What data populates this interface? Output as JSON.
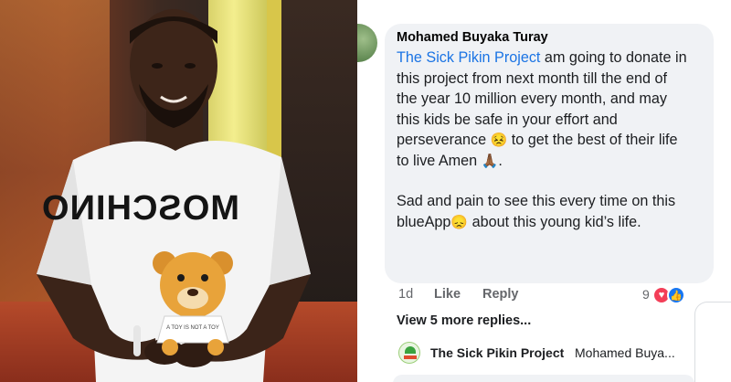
{
  "comment": {
    "author": "Mohamed Buyaka Turay",
    "mention": "The Sick Pikin Project",
    "para1_a": " am going to donate in this project from next month till the end of the year 10 million every month, and may this kids be safe in your effort and perseverance ",
    "emoji_1": "😣",
    "para1_b": " to get the best of their life to live Amen ",
    "emoji_2": "🙏🏾",
    "para1_c": ".",
    "para2_a": "Sad and pain to see this every time on this blueApp",
    "emoji_3": "😞",
    "para2_b": " about this young kid’s life."
  },
  "actions": {
    "time": "1d",
    "like": "Like",
    "reply": "Reply",
    "reaction_count": "9"
  },
  "view_more": "View 5 more replies...",
  "latest_reply": {
    "author": "The Sick Pikin Project",
    "preview": "Mohamed Buya..."
  },
  "colors": {
    "mention": "#1b74e4",
    "bubble": "#f0f2f5",
    "love": "#f33e58",
    "like": "#1877f2"
  },
  "photo": {
    "shirt_text": "MOSCHINO",
    "shirt_small_text": "A TOY IS NOT A TOY"
  }
}
